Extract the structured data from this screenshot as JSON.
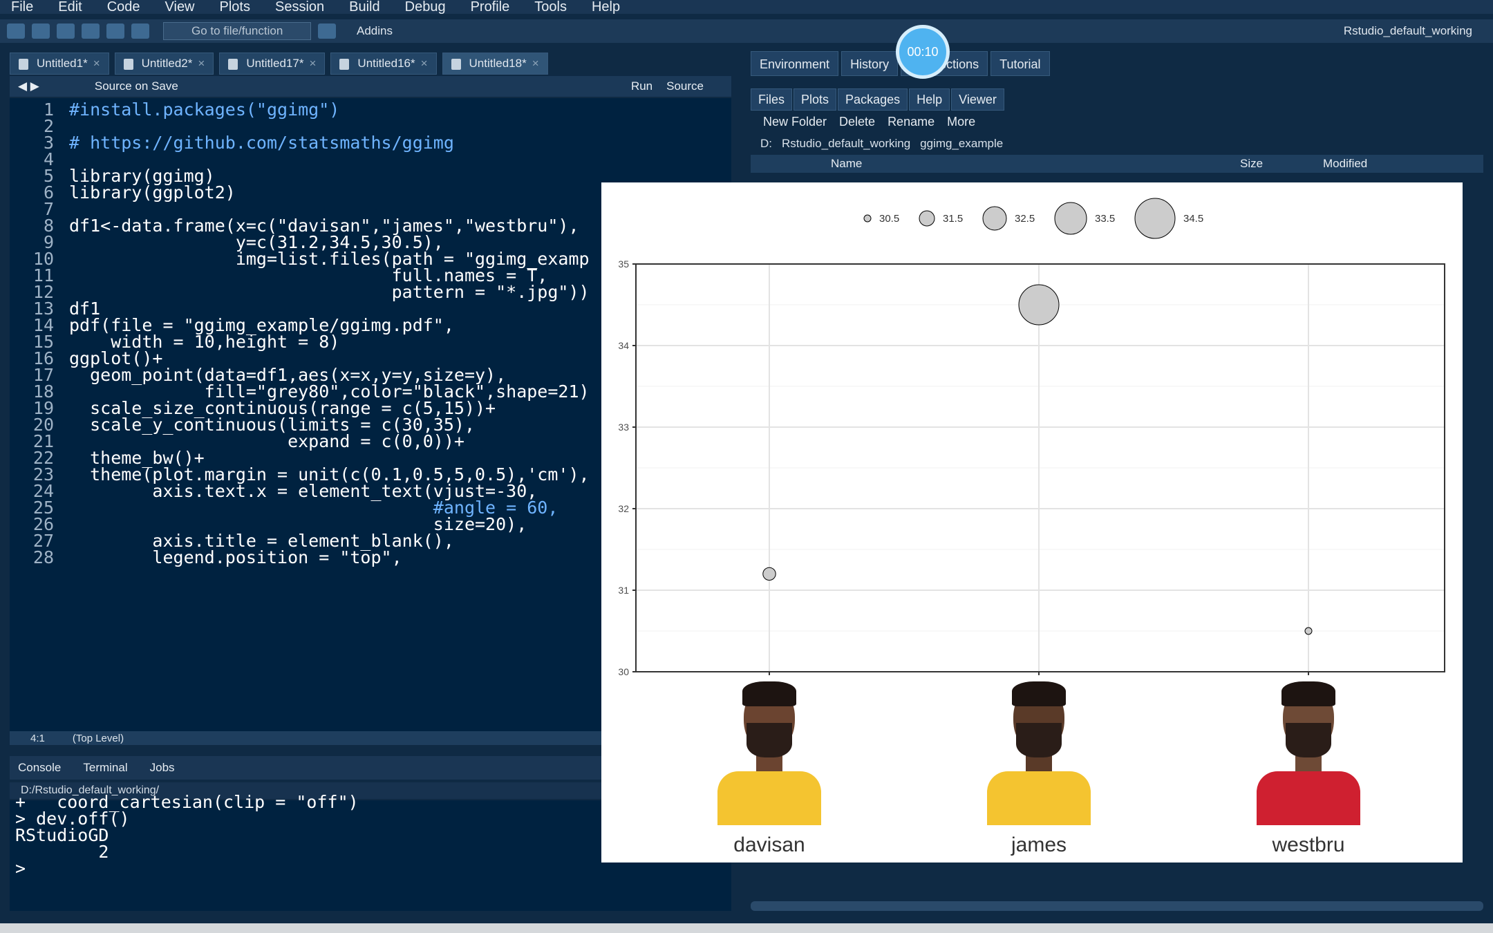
{
  "menu": [
    "File",
    "Edit",
    "Code",
    "View",
    "Plots",
    "Session",
    "Build",
    "Debug",
    "Profile",
    "Tools",
    "Help"
  ],
  "toolbar": {
    "goto_placeholder": "Go to file/function",
    "addins": "Addins",
    "project": "Rstudio_default_working"
  },
  "editor": {
    "tabs": [
      "Untitled1*",
      "Untitled2*",
      "Untitled17*",
      "Untitled16*",
      "Untitled18*"
    ],
    "active_tab": 4,
    "source_on_save": "Source on Save",
    "run": "Run",
    "source": "Source",
    "lines": [
      "#install.packages(\"ggimg\")",
      "",
      "# https://github.com/statsmaths/ggimg",
      "",
      "library(ggimg)",
      "library(ggplot2)",
      "",
      "df1<-data.frame(x=c(\"davisan\",\"james\",\"westbru\"),",
      "                y=c(31.2,34.5,30.5),",
      "                img=list.files(path = \"ggimg_examp",
      "                               full.names = T,",
      "                               pattern = \"*.jpg\"))",
      "df1",
      "pdf(file = \"ggimg_example/ggimg.pdf\",",
      "    width = 10,height = 8)",
      "ggplot()+",
      "  geom_point(data=df1,aes(x=x,y=y,size=y),",
      "             fill=\"grey80\",color=\"black\",shape=21)",
      "  scale_size_continuous(range = c(5,15))+",
      "  scale_y_continuous(limits = c(30,35),",
      "                     expand = c(0,0))+",
      "  theme_bw()+",
      "  theme(plot.margin = unit(c(0.1,0.5,5,0.5),'cm'),",
      "        axis.text.x = element_text(vjust=-30,",
      "                                   #angle = 60,",
      "                                   size=20),",
      "        axis.title = element_blank(),",
      "        legend.position = \"top\","
    ],
    "status_pos": "4:1",
    "status_scope": "(Top Level)"
  },
  "console": {
    "tabs": [
      "Console",
      "Terminal",
      "Jobs"
    ],
    "path": "D:/Rstudio_default_working/",
    "lines": [
      "+   coord_cartesian(clip = \"off\")",
      "> dev.off()",
      "RStudioGD",
      "        2",
      ">"
    ]
  },
  "right": {
    "env_tabs": [
      "Environment",
      "History",
      "Connections",
      "Tutorial"
    ],
    "timer": "00:10",
    "file_tabs": [
      "Files",
      "Plots",
      "Packages",
      "Help",
      "Viewer"
    ],
    "file_tools": [
      "New Folder",
      "Delete",
      "Rename",
      "More"
    ],
    "breadcrumb": [
      "D:",
      "Rstudio_default_working",
      "ggimg_example"
    ],
    "columns": [
      "Name",
      "Size",
      "Modified"
    ]
  },
  "chart_data": {
    "type": "scatter",
    "categories": [
      "davisan",
      "james",
      "westbru"
    ],
    "values": [
      31.2,
      34.5,
      30.5
    ],
    "ylim": [
      30,
      35
    ],
    "yticks": [
      30,
      31,
      32,
      33,
      34,
      35
    ],
    "legend": {
      "position": "top",
      "labels": [
        "30.5",
        "31.5",
        "32.5",
        "33.5",
        "34.5"
      ]
    },
    "point_fill": "#cccccc",
    "point_stroke": "#000000",
    "jerseys": [
      "#f4c430",
      "#f4c430",
      "#cf2030"
    ],
    "skins": [
      "#6b4430",
      "#5a3a28",
      "#6e4a36"
    ]
  }
}
